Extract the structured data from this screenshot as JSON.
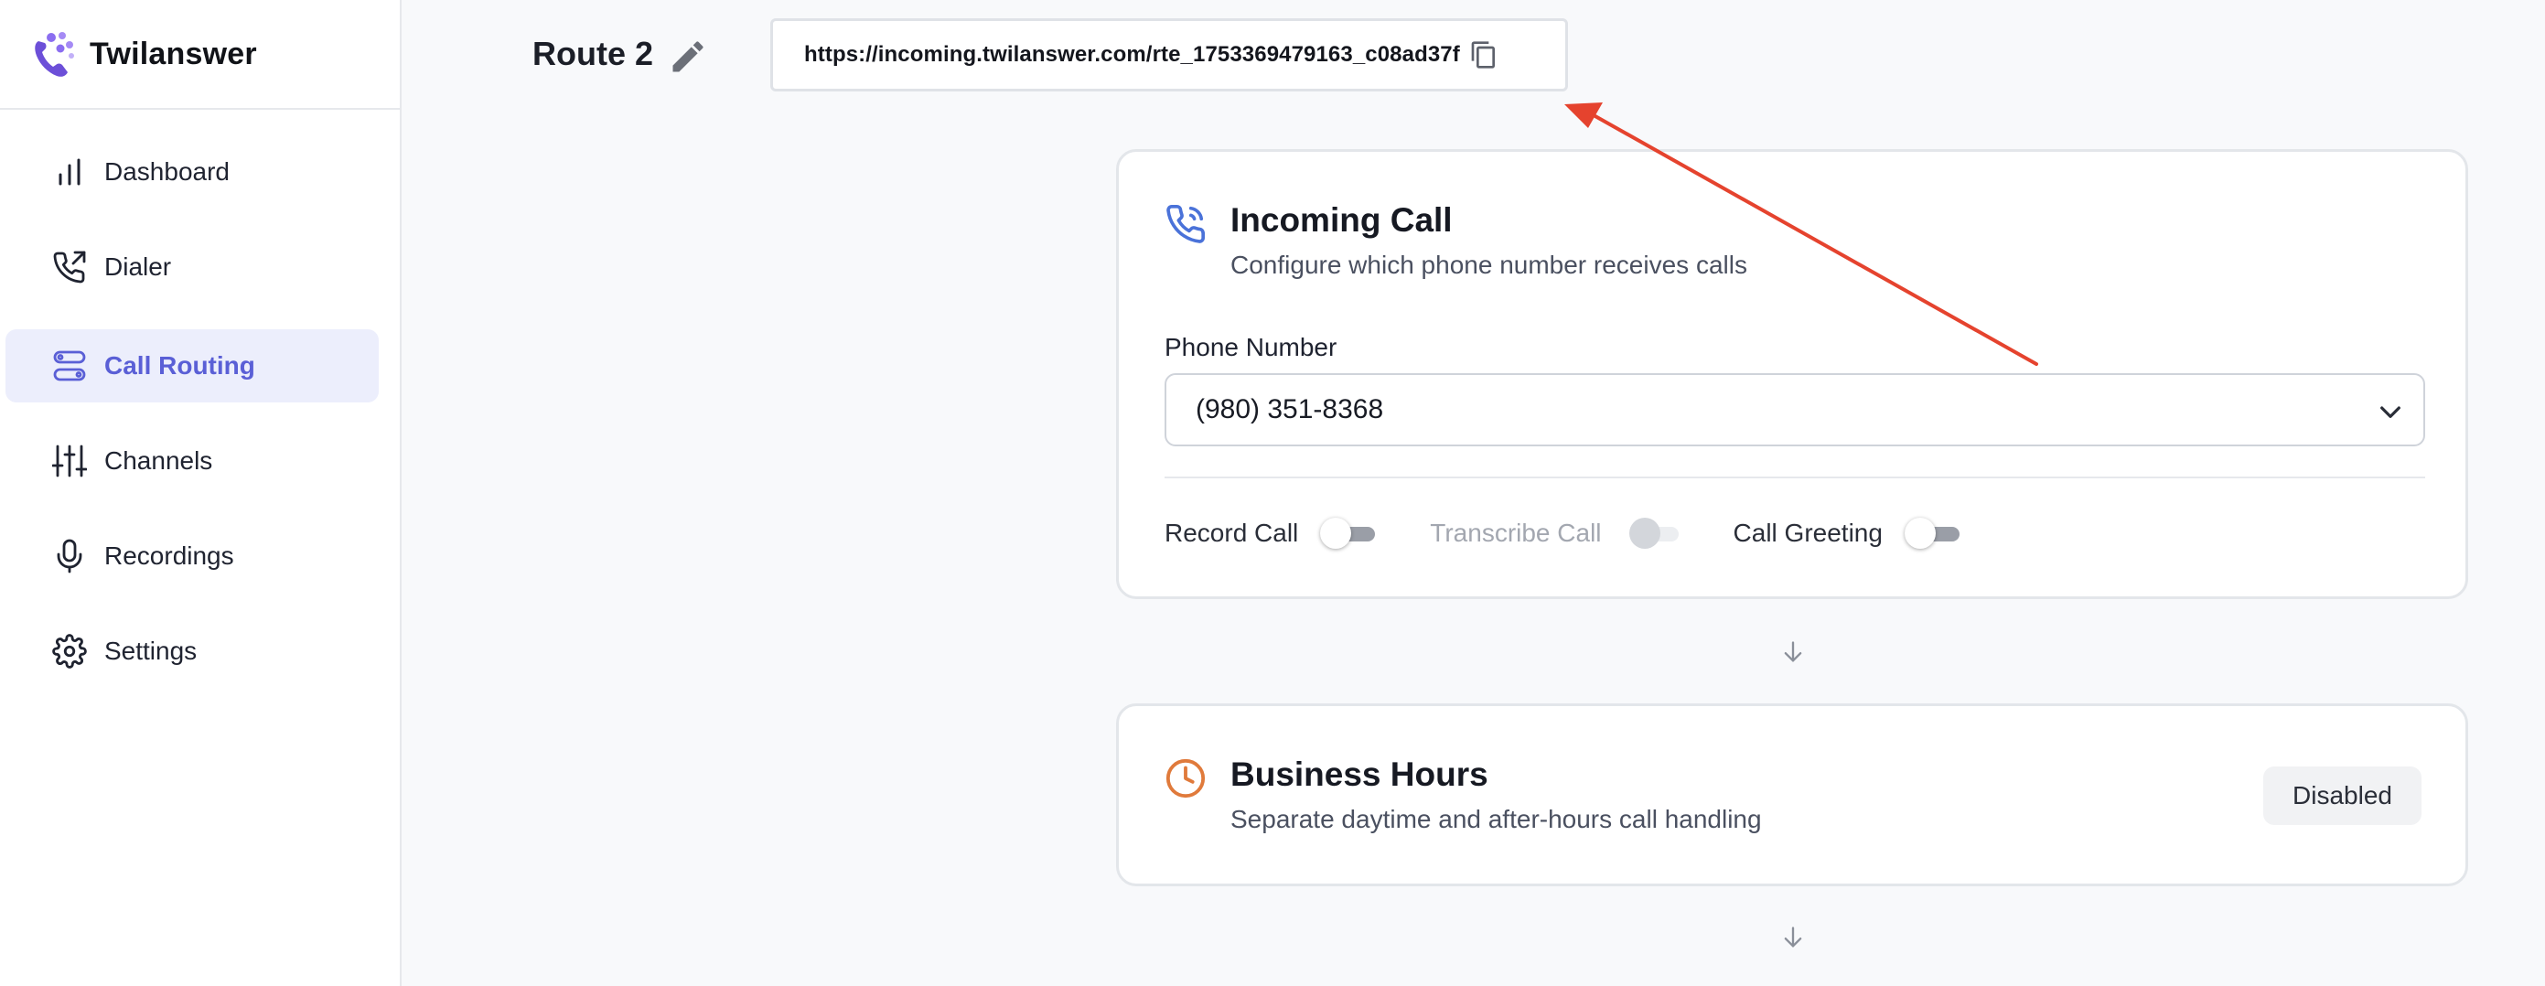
{
  "app": {
    "name": "Twilanswer"
  },
  "sidebar": {
    "items": [
      {
        "label": "Dashboard",
        "icon": "bar-chart-icon",
        "active": false
      },
      {
        "label": "Dialer",
        "icon": "phone-outgoing-icon",
        "active": false
      },
      {
        "label": "Call Routing",
        "icon": "route-icon",
        "active": true
      },
      {
        "label": "Channels",
        "icon": "sliders-icon",
        "active": false
      },
      {
        "label": "Recordings",
        "icon": "microphone-icon",
        "active": false
      },
      {
        "label": "Settings",
        "icon": "gear-icon",
        "active": false
      }
    ]
  },
  "header": {
    "route_name": "Route 2",
    "webhook_url": "https://incoming.twilanswer.com/rte_1753369479163_c08ad37f"
  },
  "incoming_call": {
    "title": "Incoming Call",
    "subtitle": "Configure which phone number receives calls",
    "phone_label": "Phone Number",
    "phone_value": "(980) 351-8368",
    "toggles": [
      {
        "label": "Record Call",
        "on": false,
        "disabled": false
      },
      {
        "label": "Transcribe Call",
        "on": false,
        "disabled": true
      },
      {
        "label": "Call Greeting",
        "on": false,
        "disabled": false
      }
    ]
  },
  "business_hours": {
    "title": "Business Hours",
    "subtitle": "Separate daytime and after-hours call handling",
    "status": "Disabled"
  },
  "colors": {
    "accent": "#5a5fd6",
    "active_bg": "#eceefc",
    "phone_icon": "#4a72d9",
    "clock_icon": "#e07a3b",
    "annotation_arrow": "#e5432e"
  }
}
